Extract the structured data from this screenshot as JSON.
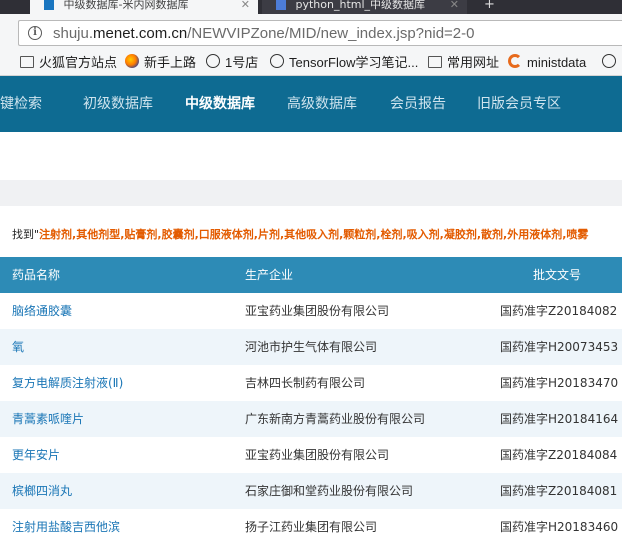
{
  "browser": {
    "tabs": [
      {
        "title": "中级数据库-米内网数据库"
      },
      {
        "title": "python_html_中级数据库"
      }
    ],
    "url": {
      "prefix": "shuju.",
      "domain": "menet.com.cn",
      "path": "/NEWVIPZone/MID/new_index.jsp?nid=2-0"
    },
    "bookmarks": [
      {
        "label": "火狐官方站点",
        "icon": "folder-icon"
      },
      {
        "label": "新手上路",
        "icon": "firefox-icon"
      },
      {
        "label": "1号店",
        "icon": "globe-icon"
      },
      {
        "label": "TensorFlow学习笔记...",
        "icon": "folder-icon"
      },
      {
        "label": "常用网址",
        "icon": "folder-icon"
      },
      {
        "label": "ministdata",
        "icon": "ring-icon"
      }
    ]
  },
  "nav": {
    "items": [
      {
        "label": "一键检索"
      },
      {
        "label": "初级数据库"
      },
      {
        "label": "中级数据库",
        "active": true
      },
      {
        "label": "高级数据库"
      },
      {
        "label": "会员报告"
      },
      {
        "label": "旧版会员专区"
      }
    ]
  },
  "found": {
    "prefix": "找到\"",
    "types": "注射剂,其他剂型,贴膏剂,胶囊剂,口服液体剂,片剂,其他吸入剂,颗粒剂,栓剂,吸入剂,凝胶剂,散剂,外用液体剂,喷雾"
  },
  "table": {
    "headers": [
      "药品名称",
      "生产企业",
      "批文文号"
    ],
    "rows": [
      [
        "脑络通胶囊",
        "亚宝药业集团股份有限公司",
        "国药准字Z20184082"
      ],
      [
        "氧",
        "河池市护生气体有限公司",
        "国药准字H20073453"
      ],
      [
        "复方电解质注射液(Ⅱ)",
        "吉林四长制药有限公司",
        "国药准字H20183470"
      ],
      [
        "青蒿素哌喹片",
        "广东新南方青蒿药业股份有限公司",
        "国药准字H20184164"
      ],
      [
        "更年安片",
        "亚宝药业集团股份有限公司",
        "国药准字Z20184084"
      ],
      [
        "槟榔四消丸",
        "石家庄御和堂药业股份有限公司",
        "国药准字Z20184081"
      ],
      [
        "注射用盐酸吉西他滨",
        "扬子江药业集团有限公司",
        "国药准字H20183460"
      ]
    ]
  },
  "colors": {
    "nav_bg": "#0e6b92",
    "table_header_bg": "#2d8bb6",
    "accent_orange": "#e35b00",
    "link_blue": "#1a76b6"
  }
}
